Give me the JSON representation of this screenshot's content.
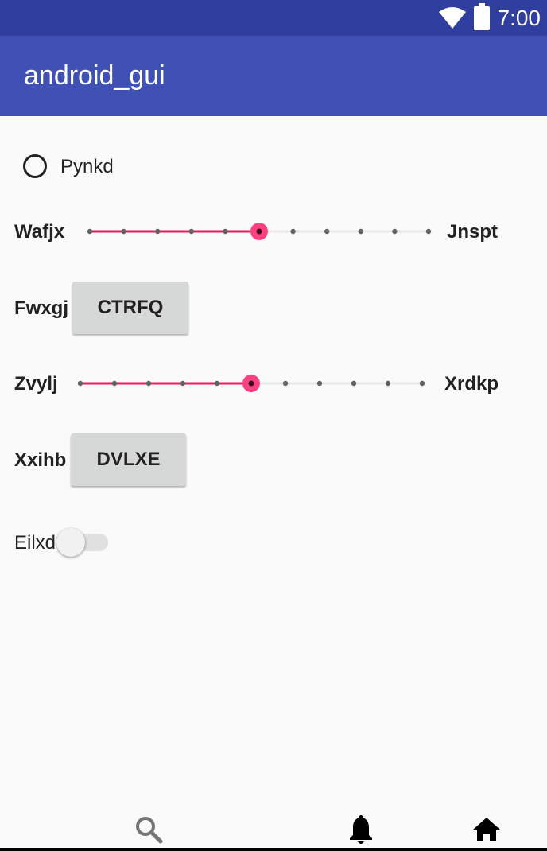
{
  "status_bar": {
    "time": "7:00",
    "wifi_icon": "wifi-icon",
    "battery_icon": "battery-icon"
  },
  "app_bar": {
    "title": "android_gui"
  },
  "radio": {
    "label": "Pynkd",
    "checked": false
  },
  "slider1": {
    "left_label": "Wafjx",
    "right_label": "Jnspt",
    "steps": 10,
    "value": 5
  },
  "row_button1": {
    "label": "Fwxgj",
    "button": "CTRFQ"
  },
  "slider2": {
    "left_label": "Zvylj",
    "right_label": "Xrdkp",
    "steps": 10,
    "value": 5
  },
  "row_button2": {
    "label": "Xxihb",
    "button": "DVLXE"
  },
  "switch": {
    "label": "Eilxd",
    "on": false
  },
  "bottom_nav": {
    "icons": [
      "search-icon",
      "bell-icon",
      "home-icon"
    ]
  },
  "colors": {
    "status_bar": "#303f9f",
    "app_bar": "#3f51b5",
    "accent": "#ff4081",
    "slider_active": "#e91e63"
  }
}
